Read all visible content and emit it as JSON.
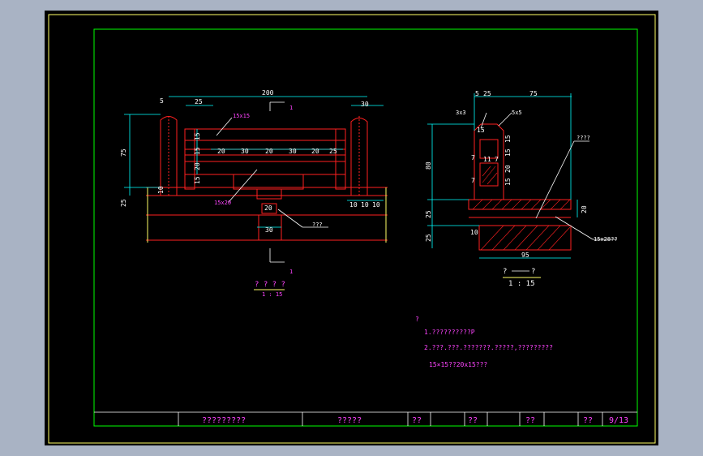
{
  "colors": {
    "background": "#a9b3c4",
    "sheet": "#000000",
    "frame": "#00ff00",
    "outer_border": "#ffff66",
    "outline": "#ff2020",
    "dimension": "#00ffff",
    "text": "#ff44ff",
    "leader": "#ffffff"
  },
  "front_view": {
    "dim_total": "200",
    "dim_post_left": "25",
    "dim_post_right": "30",
    "dim_top": "5",
    "dim_height_75": "75",
    "dim_height_25": "25",
    "dim_rail_left": "10",
    "rail_spacing": [
      "20",
      "30",
      "20",
      "30",
      "20",
      "25"
    ],
    "rail_heights": [
      "15",
      "15",
      "20",
      "15"
    ],
    "bottom_dims": [
      "10",
      "10",
      "10"
    ],
    "dim_20": "20",
    "dim_30": "30",
    "label_rail_top": "15x15",
    "label_rail_bottom": "15x20",
    "label_base": "???",
    "section_mark": "1",
    "title": "? ? ? ?",
    "scale": "1 : 15"
  },
  "side_view": {
    "dim_5": "5",
    "dim_25": "25",
    "dim_75": "75",
    "label_chamfer_left": "3x3",
    "label_chamfer_right": "5x5",
    "dim_80": "80",
    "dim_lower_25_a": "25",
    "dim_lower_25_b": "25",
    "dim_20": "20",
    "dim_10": "10",
    "dim_95": "95",
    "inner_dims_left": [
      "15",
      "7",
      "7"
    ],
    "inner_dims_right": [
      "15",
      "15",
      "20",
      "15"
    ],
    "inner_dims_mid": [
      "11",
      "7"
    ],
    "label_leader": "????",
    "label_slab": "15x28??",
    "title_a": "?",
    "title_b": "?",
    "scale": "1 : 15"
  },
  "notes": {
    "heading": "?",
    "line1": "1.??????????P",
    "line2": "2.???.???.???????.?????,?????????",
    "line3": "15×15??20x15???"
  },
  "title_block": {
    "drawing_name": "?????????",
    "cell2": "?????",
    "cell3": "??",
    "cell4": "??",
    "cell5": "??",
    "cell6": "??",
    "sheet_number": "9/13"
  }
}
